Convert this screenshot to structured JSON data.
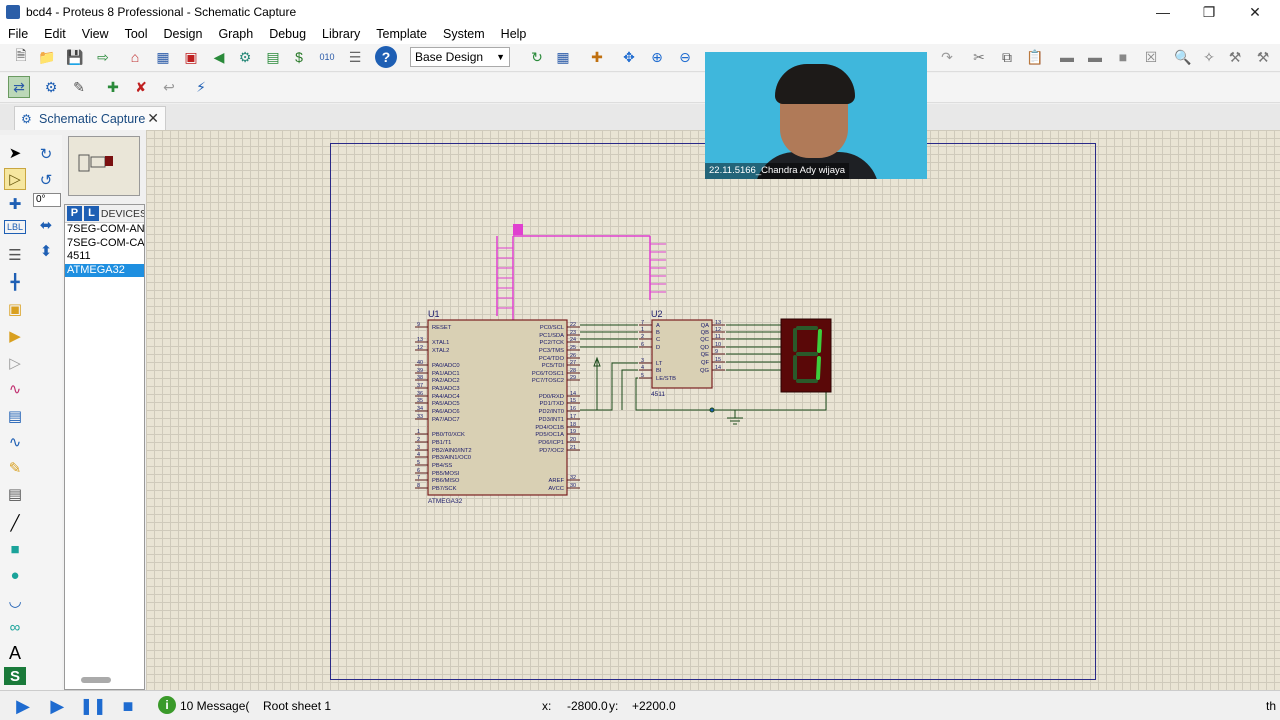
{
  "window": {
    "title": "bcd4 - Proteus 8 Professional - Schematic Capture"
  },
  "menu": [
    "File",
    "Edit",
    "View",
    "Tool",
    "Design",
    "Graph",
    "Debug",
    "Library",
    "Template",
    "System",
    "Help"
  ],
  "toolbar": {
    "design_select": "Base Design"
  },
  "tab": {
    "label": "Schematic Capture"
  },
  "rotation": {
    "value": "0°"
  },
  "devices": {
    "p_label": "P",
    "l_label": "L",
    "header": "DEVICES",
    "items": [
      "7SEG-COM-AN",
      "7SEG-COM-CA",
      "4511",
      "ATMEGA32"
    ],
    "selected_index": 3
  },
  "schematic": {
    "u1": {
      "ref": "U1",
      "part": "ATMEGA32",
      "left_pins": [
        {
          "num": "9",
          "name": "RESET"
        },
        {
          "num": "13",
          "name": "XTAL1"
        },
        {
          "num": "12",
          "name": "XTAL2"
        },
        {
          "num": "40",
          "name": "PA0/ADC0"
        },
        {
          "num": "39",
          "name": "PA1/ADC1"
        },
        {
          "num": "38",
          "name": "PA2/ADC2"
        },
        {
          "num": "37",
          "name": "PA3/ADC3"
        },
        {
          "num": "36",
          "name": "PA4/ADC4"
        },
        {
          "num": "35",
          "name": "PA5/ADC5"
        },
        {
          "num": "34",
          "name": "PA6/ADC6"
        },
        {
          "num": "33",
          "name": "PA7/ADC7"
        },
        {
          "num": "1",
          "name": "PB0/T0/XCK"
        },
        {
          "num": "2",
          "name": "PB1/T1"
        },
        {
          "num": "3",
          "name": "PB2/AIN0/INT2"
        },
        {
          "num": "4",
          "name": "PB3/AIN1/OC0"
        },
        {
          "num": "5",
          "name": "PB4/SS"
        },
        {
          "num": "6",
          "name": "PB5/MOSI"
        },
        {
          "num": "7",
          "name": "PB6/MISO"
        },
        {
          "num": "8",
          "name": "PB7/SCK"
        }
      ],
      "right_pins": [
        {
          "num": "22",
          "name": "PC0/SCL"
        },
        {
          "num": "23",
          "name": "PC1/SDA"
        },
        {
          "num": "24",
          "name": "PC2/TCK"
        },
        {
          "num": "25",
          "name": "PC3/TMS"
        },
        {
          "num": "26",
          "name": "PC4/TDO"
        },
        {
          "num": "27",
          "name": "PC5/TDI"
        },
        {
          "num": "28",
          "name": "PC6/TOSC1"
        },
        {
          "num": "29",
          "name": "PC7/TOSC2"
        },
        {
          "num": "14",
          "name": "PD0/RXD"
        },
        {
          "num": "15",
          "name": "PD1/TXD"
        },
        {
          "num": "16",
          "name": "PD2/INT0"
        },
        {
          "num": "17",
          "name": "PD3/INT1"
        },
        {
          "num": "18",
          "name": "PD4/OC1B"
        },
        {
          "num": "19",
          "name": "PD5/OC1A"
        },
        {
          "num": "20",
          "name": "PD6/ICP1"
        },
        {
          "num": "21",
          "name": "PD7/OC2"
        },
        {
          "num": "32",
          "name": "AREF"
        },
        {
          "num": "30",
          "name": "AVCC"
        }
      ]
    },
    "u2": {
      "ref": "U2",
      "part": "4511",
      "left_pins": [
        {
          "num": "7",
          "name": "A"
        },
        {
          "num": "1",
          "name": "B"
        },
        {
          "num": "2",
          "name": "C"
        },
        {
          "num": "6",
          "name": "D"
        },
        {
          "num": "3",
          "name": "LT"
        },
        {
          "num": "4",
          "name": "BI"
        },
        {
          "num": "5",
          "name": "LE/STB"
        }
      ],
      "right_pins": [
        {
          "num": "13",
          "name": "QA"
        },
        {
          "num": "12",
          "name": "QB"
        },
        {
          "num": "11",
          "name": "QC"
        },
        {
          "num": "10",
          "name": "QD"
        },
        {
          "num": "9",
          "name": "QE"
        },
        {
          "num": "15",
          "name": "QF"
        },
        {
          "num": "14",
          "name": "QG"
        }
      ]
    },
    "display_digit": "1"
  },
  "webcam": {
    "caption": "22.11.5166_Chandra Ady wijaya"
  },
  "status": {
    "messages": "10 Message(",
    "sheet": "Root sheet 1",
    "x_label": "x:",
    "x_value": "-2800.0",
    "y_label": "y:",
    "y_value": "+2200.0",
    "trailing": "th"
  }
}
